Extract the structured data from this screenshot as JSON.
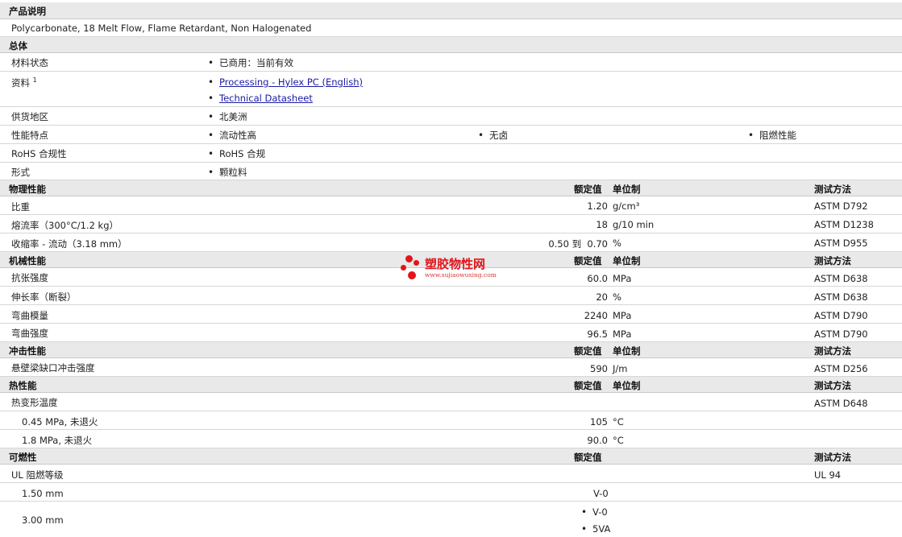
{
  "product": {
    "title": "产品说明",
    "description": "Polycarbonate, 18 Melt Flow, Flame Retardant, Non Halogenated"
  },
  "general": {
    "title": "总体",
    "material_status_label": "材料状态",
    "material_status_value": "已商用：当前有效",
    "docs_label": "资料",
    "docs_sup": "1",
    "doc_link_1": "Processing - Hylex PC (English)",
    "doc_link_2": "Technical Datasheet",
    "availability_label": "供货地区",
    "availability_value": "北美洲",
    "features_label": "性能特点",
    "feature_1": "流动性高",
    "feature_2": "无卤",
    "feature_3": "阻燃性能",
    "rohs_label": "RoHS 合规性",
    "rohs_value": "RoHS 合规",
    "form_label": "形式",
    "form_value": "颗粒料"
  },
  "physical": {
    "title": "物理性能",
    "col_nominal": "额定值",
    "col_unit": "单位制",
    "col_method": "测试方法",
    "rows": [
      {
        "name": "比重",
        "value": "1.20",
        "unit": "g/cm³",
        "method": "ASTM D792"
      },
      {
        "name": "熔流率（300°C/1.2 kg）",
        "value": "18",
        "unit": "g/10 min",
        "method": "ASTM D1238"
      },
      {
        "name": "收缩率 - 流动（3.18 mm）",
        "value": "0.50 到  0.70",
        "unit": "%",
        "method": "ASTM D955"
      }
    ]
  },
  "mechanical": {
    "title": "机械性能",
    "col_nominal": "额定值",
    "col_unit": "单位制",
    "col_method": "测试方法",
    "rows": [
      {
        "name": "抗张强度",
        "value": "60.0",
        "unit": "MPa",
        "method": "ASTM D638"
      },
      {
        "name": "伸长率（断裂）",
        "value": "20",
        "unit": "%",
        "method": "ASTM D638"
      },
      {
        "name": "弯曲模量",
        "value": "2240",
        "unit": "MPa",
        "method": "ASTM D790"
      },
      {
        "name": "弯曲强度",
        "value": "96.5",
        "unit": "MPa",
        "method": "ASTM D790"
      }
    ]
  },
  "impact": {
    "title": "冲击性能",
    "col_nominal": "额定值",
    "col_unit": "单位制",
    "col_method": "测试方法",
    "rows": [
      {
        "name": "悬壁梁缺口冲击强度",
        "value": "590",
        "unit": "J/m",
        "method": "ASTM D256"
      }
    ]
  },
  "thermal": {
    "title": "热性能",
    "col_nominal": "额定值",
    "col_unit": "单位制",
    "col_method": "测试方法",
    "hdt_label": "热变形温度",
    "hdt_method": "ASTM D648",
    "rows": [
      {
        "name": "0.45 MPa, 未退火",
        "value": "105",
        "unit": "°C"
      },
      {
        "name": "1.8 MPa, 未退火",
        "value": "90.0",
        "unit": "°C"
      }
    ]
  },
  "flammability": {
    "title": "可燃性",
    "col_nominal": "额定值",
    "col_method": "测试方法",
    "ul_label": "UL 阻燃等级",
    "ul_method": "UL 94",
    "row1_name": "1.50 mm",
    "row1_value": "V-0",
    "row2_name": "3.00 mm",
    "row2_value_1": "V-0",
    "row2_value_2": "5VA"
  },
  "watermark": {
    "name": "塑胶物性网",
    "url": "www.sujiaowuxing.com",
    "color": "#e0161c"
  }
}
